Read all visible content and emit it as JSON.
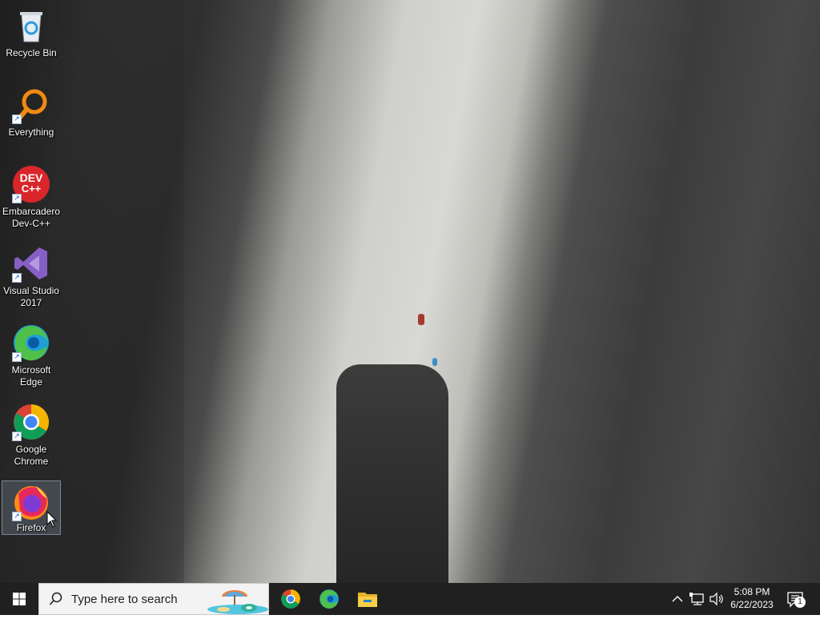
{
  "desktop": {
    "icons": [
      {
        "label": "Recycle Bin",
        "icon": "recycle-bin-icon"
      },
      {
        "label": "Everything",
        "icon": "everything-search-icon"
      },
      {
        "label": "Embarcadero Dev-C++",
        "icon": "devcpp-icon",
        "badge_line1": "DEV",
        "badge_line2": "C++"
      },
      {
        "label": "Visual Studio 2017",
        "icon": "visual-studio-icon"
      },
      {
        "label": "Microsoft Edge",
        "icon": "edge-icon"
      },
      {
        "label": "Google Chrome",
        "icon": "chrome-icon"
      },
      {
        "label": "Firefox",
        "icon": "firefox-icon"
      }
    ],
    "selected_icon": "Firefox"
  },
  "taskbar": {
    "search_placeholder": "Type here to search",
    "pinned_apps": [
      "chrome-icon",
      "edge-icon",
      "file-explorer-icon"
    ],
    "clock_time": "5:08 PM",
    "clock_date": "6/22/2023",
    "notification_count": "1"
  },
  "colors": {
    "taskbar_bg": "#202020",
    "search_bg": "#f3f3f3",
    "windows_blue": "#ffffff"
  }
}
